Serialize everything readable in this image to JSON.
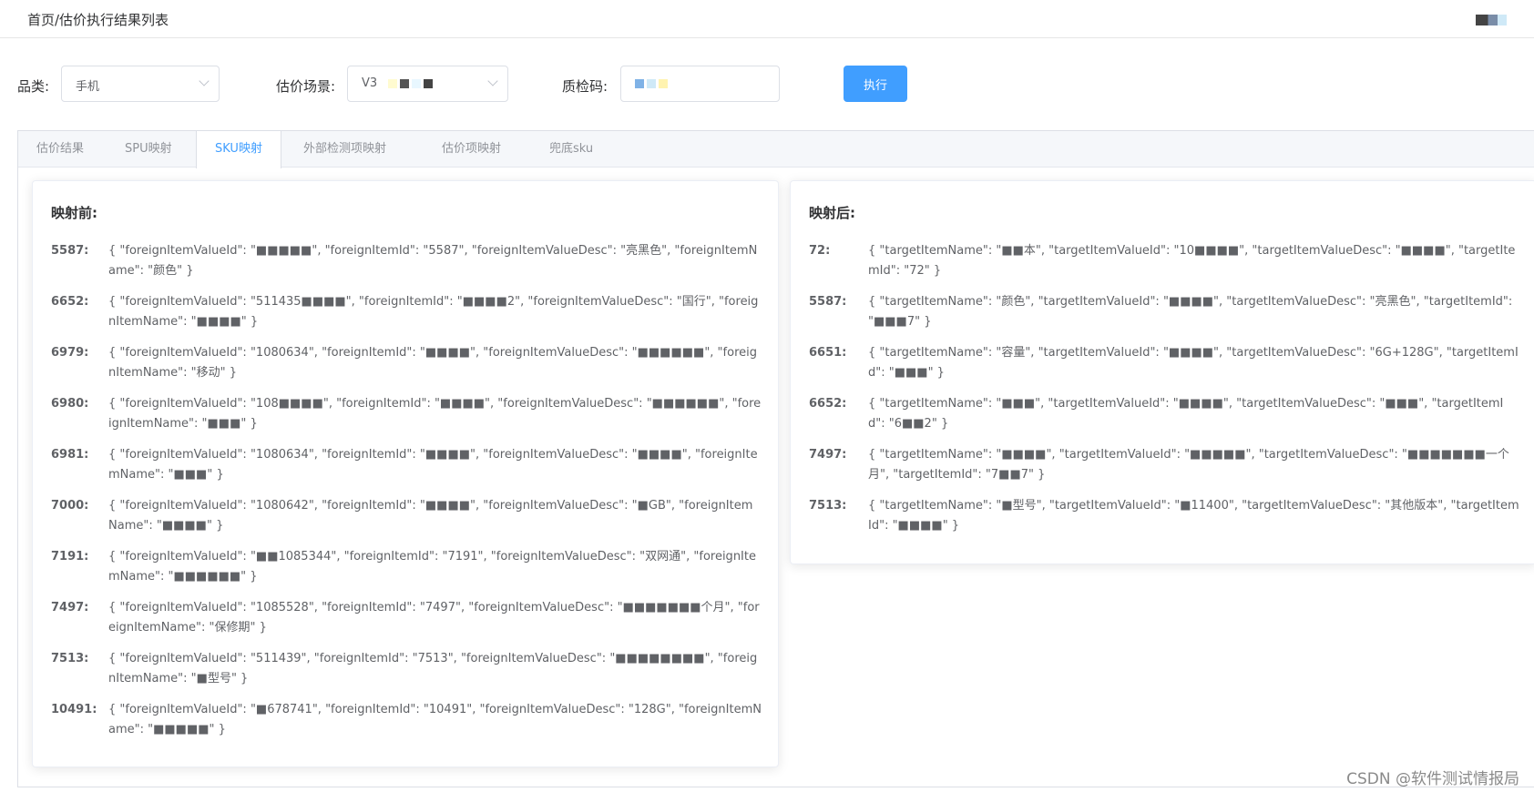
{
  "header": {
    "breadcrumb": "首页/估价执行结果列表"
  },
  "filters": {
    "category_label": "品类:",
    "category_value": "手机",
    "scene_label": "估价场景:",
    "scene_value": "V3",
    "qc_label": "质检码:",
    "run_label": "执行"
  },
  "tabs": [
    {
      "label": "估价结果"
    },
    {
      "label": "SPU映射"
    },
    {
      "label": "SKU映射"
    },
    {
      "label": "外部检测项映射"
    },
    {
      "label": "估价项映射"
    },
    {
      "label": "兜底sku"
    }
  ],
  "before": {
    "title": "映射前:",
    "items": [
      {
        "key": "5587:",
        "value": "{ \"foreignItemValueId\": \"■■■■■\", \"foreignItemId\": \"5587\", \"foreignItemValueDesc\": \"亮黑色\", \"foreignItemName\": \"颜色\" }"
      },
      {
        "key": "6652:",
        "value": "{ \"foreignItemValueId\": \"511435■■■■\", \"foreignItemId\": \"■■■■2\", \"foreignItemValueDesc\": \"国行\", \"foreignItemName\": \"■■■■\" }"
      },
      {
        "key": "6979:",
        "value": "{ \"foreignItemValueId\": \"1080634\", \"foreignItemId\": \"■■■■\", \"foreignItemValueDesc\": \"■■■■■■\", \"foreignItemName\": \"移动\" }"
      },
      {
        "key": "6980:",
        "value": "{ \"foreignItemValueId\": \"108■■■■\", \"foreignItemId\": \"■■■■\", \"foreignItemValueDesc\": \"■■■■■■\", \"foreignItemName\": \"■■■\" }"
      },
      {
        "key": "6981:",
        "value": "{ \"foreignItemValueId\": \"1080634\", \"foreignItemId\": \"■■■■\", \"foreignItemValueDesc\": \"■■■■\", \"foreignItemName\": \"■■■\" }"
      },
      {
        "key": "7000:",
        "value": "{ \"foreignItemValueId\": \"1080642\", \"foreignItemId\": \"■■■■\", \"foreignItemValueDesc\": \"■GB\", \"foreignItemName\": \"■■■■\" }"
      },
      {
        "key": "7191:",
        "value": "{ \"foreignItemValueId\": \"■■1085344\", \"foreignItemId\": \"7191\", \"foreignItemValueDesc\": \"双网通\", \"foreignItemName\": \"■■■■■■\" }"
      },
      {
        "key": "7497:",
        "value": "{ \"foreignItemValueId\": \"1085528\", \"foreignItemId\": \"7497\", \"foreignItemValueDesc\": \"■■■■■■■个月\", \"foreignItemName\": \"保修期\" }"
      },
      {
        "key": "7513:",
        "value": "{ \"foreignItemValueId\": \"511439\", \"foreignItemId\": \"7513\", \"foreignItemValueDesc\": \"■■■■■■■■\", \"foreignItemName\": \"■型号\" }"
      },
      {
        "key": "10491:",
        "value": "{ \"foreignItemValueId\": \"■678741\", \"foreignItemId\": \"10491\", \"foreignItemValueDesc\": \"128G\", \"foreignItemName\": \"■■■■■\" }"
      }
    ]
  },
  "after": {
    "title": "映射后:",
    "items": [
      {
        "key": "72:",
        "value": "{ \"targetItemName\": \"■■本\", \"targetItemValueId\": \"10■■■■\", \"targetItemValueDesc\": \"■■■■\", \"targetItemId\": \"72\" }"
      },
      {
        "key": "5587:",
        "value": "{ \"targetItemName\": \"颜色\", \"targetItemValueId\": \"■■■■\", \"targetItemValueDesc\": \"亮黑色\", \"targetItemId\": \"■■■7\" }"
      },
      {
        "key": "6651:",
        "value": "{ \"targetItemName\": \"容量\", \"targetItemValueId\": \"■■■■\", \"targetItemValueDesc\": \"6G+128G\", \"targetItemId\": \"■■■\" }"
      },
      {
        "key": "6652:",
        "value": "{ \"targetItemName\": \"■■■\", \"targetItemValueId\": \"■■■■\", \"targetItemValueDesc\": \"■■■\", \"targetItemId\": \"6■■2\" }"
      },
      {
        "key": "7497:",
        "value": "{ \"targetItemName\": \"■■■■\", \"targetItemValueId\": \"■■■■■\", \"targetItemValueDesc\": \"■■■■■■■一个月\", \"targetItemId\": \"7■■7\" }"
      },
      {
        "key": "7513:",
        "value": "{ \"targetItemName\": \"■型号\", \"targetItemValueId\": \"■11400\", \"targetItemValueDesc\": \"其他版本\", \"targetItemId\": \"■■■■\" }"
      }
    ]
  },
  "watermark": "CSDN @软件测试情报局"
}
